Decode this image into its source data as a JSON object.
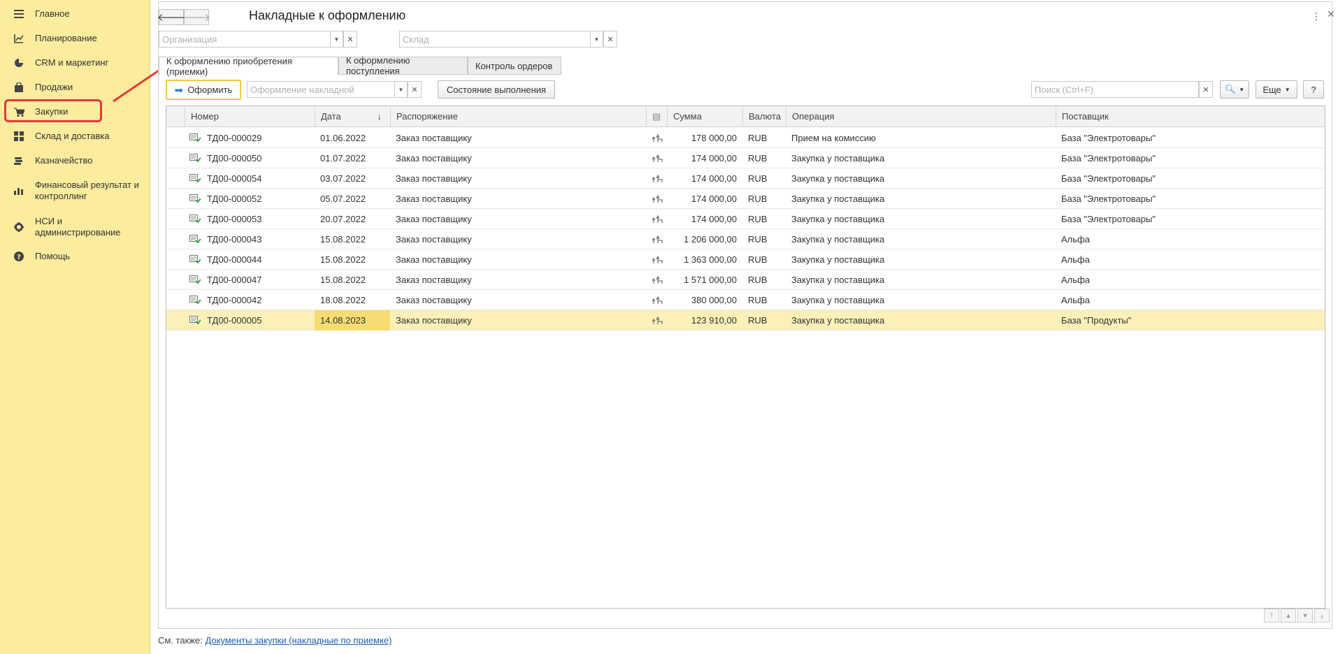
{
  "sidebar": {
    "items": [
      {
        "label": "Главное",
        "icon": "menu-icon"
      },
      {
        "label": "Планирование",
        "icon": "planning-icon"
      },
      {
        "label": "CRM и маркетинг",
        "icon": "pie-chart-icon"
      },
      {
        "label": "Продажи",
        "icon": "shopping-bag-icon"
      },
      {
        "label": "Закупки",
        "icon": "cart-icon"
      },
      {
        "label": "Склад и доставка",
        "icon": "grid-icon"
      },
      {
        "label": "Казначейство",
        "icon": "coins-icon"
      },
      {
        "label": "Финансовый результат и контроллинг",
        "icon": "bar-chart-icon"
      },
      {
        "label": "НСИ и администрирование",
        "icon": "gear-icon"
      },
      {
        "label": "Помощь",
        "icon": "help-icon"
      }
    ],
    "active_index": 4
  },
  "header": {
    "title": "Накладные к оформлению"
  },
  "filters": {
    "organization_placeholder": "Организация",
    "warehouse_placeholder": "Склад"
  },
  "tabs": [
    {
      "label": "К оформлению приобретения (приемки)",
      "active": true
    },
    {
      "label": "К оформлению поступления",
      "active": false
    },
    {
      "label": "Контроль ордеров",
      "active": false
    }
  ],
  "toolbar": {
    "process_label": "Оформить",
    "invoice_placeholder": "Оформление накладной",
    "status_label": "Состояние выполнения",
    "search_placeholder": "Поиск (Ctrl+F)",
    "more_label": "Еще",
    "help_label": "?"
  },
  "table": {
    "columns": [
      "Номер",
      "Дата",
      "Распоряжение",
      "Сумма",
      "Валюта",
      "Операция",
      "Поставщик"
    ],
    "rows": [
      {
        "number": "ТД00-000029",
        "date": "01.06.2022",
        "order": "Заказ поставщику",
        "sum": "178 000,00",
        "currency": "RUB",
        "operation": "Прием на комиссию",
        "supplier": "База \"Электротовары\""
      },
      {
        "number": "ТД00-000050",
        "date": "01.07.2022",
        "order": "Заказ поставщику",
        "sum": "174 000,00",
        "currency": "RUB",
        "operation": "Закупка у поставщика",
        "supplier": "База \"Электротовары\""
      },
      {
        "number": "ТД00-000054",
        "date": "03.07.2022",
        "order": "Заказ поставщику",
        "sum": "174 000,00",
        "currency": "RUB",
        "operation": "Закупка у поставщика",
        "supplier": "База \"Электротовары\""
      },
      {
        "number": "ТД00-000052",
        "date": "05.07.2022",
        "order": "Заказ поставщику",
        "sum": "174 000,00",
        "currency": "RUB",
        "operation": "Закупка у поставщика",
        "supplier": "База \"Электротовары\""
      },
      {
        "number": "ТД00-000053",
        "date": "20.07.2022",
        "order": "Заказ поставщику",
        "sum": "174 000,00",
        "currency": "RUB",
        "operation": "Закупка у поставщика",
        "supplier": "База \"Электротовары\""
      },
      {
        "number": "ТД00-000043",
        "date": "15.08.2022",
        "order": "Заказ поставщику",
        "sum": "1 206 000,00",
        "currency": "RUB",
        "operation": "Закупка у поставщика",
        "supplier": "Альфа"
      },
      {
        "number": "ТД00-000044",
        "date": "15.08.2022",
        "order": "Заказ поставщику",
        "sum": "1 363 000,00",
        "currency": "RUB",
        "operation": "Закупка у поставщика",
        "supplier": "Альфа"
      },
      {
        "number": "ТД00-000047",
        "date": "15.08.2022",
        "order": "Заказ поставщику",
        "sum": "1 571 000,00",
        "currency": "RUB",
        "operation": "Закупка у поставщика",
        "supplier": "Альфа"
      },
      {
        "number": "ТД00-000042",
        "date": "18.08.2022",
        "order": "Заказ поставщику",
        "sum": "380 000,00",
        "currency": "RUB",
        "operation": "Закупка у поставщика",
        "supplier": "Альфа"
      },
      {
        "number": "ТД00-000005",
        "date": "14.08.2023",
        "order": "Заказ поставщику",
        "sum": "123 910,00",
        "currency": "RUB",
        "operation": "Закупка у поставщика",
        "supplier": "База \"Продукты\""
      }
    ],
    "selected_index": 9
  },
  "footer": {
    "see_also": "См. также:",
    "link": "Документы закупки (накладные по приемке)"
  },
  "colors": {
    "sidebar_bg": "#fbec9e",
    "highlight": "#e53935",
    "selected_row": "#fbf0b8",
    "link": "#1a5fb4"
  }
}
